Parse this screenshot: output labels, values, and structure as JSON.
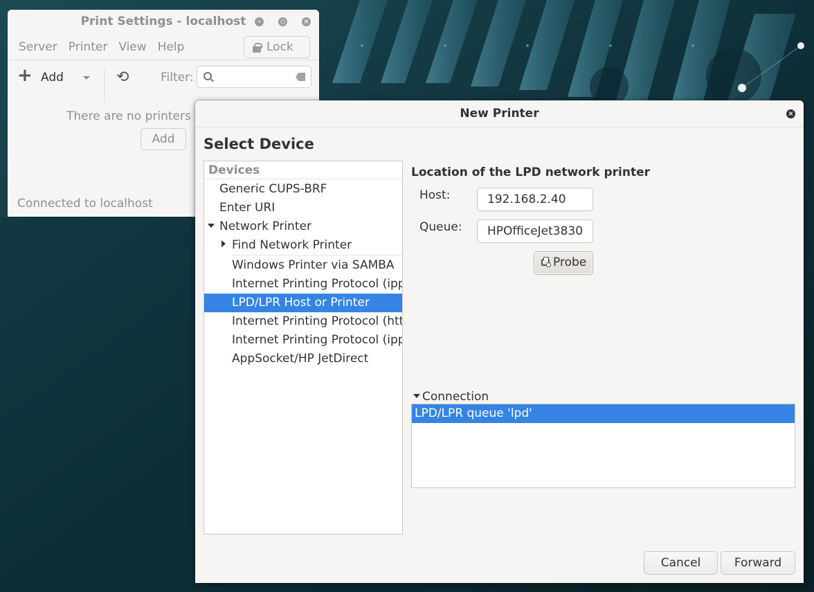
{
  "background_window": {
    "title": "Print Settings - localhost",
    "menu": [
      "Server",
      "Printer",
      "View",
      "Help"
    ],
    "lock_label": "Lock",
    "add_label": "Add",
    "filter_label": "Filter:",
    "filter_placeholder": "",
    "empty_message": "There are no printers co",
    "empty_add_label": "Add",
    "status": "Connected to localhost"
  },
  "dialog": {
    "title": "New Printer",
    "heading": "Select Device",
    "devices_header": "Devices",
    "devices": {
      "generic": "Generic CUPS-BRF",
      "enter_uri": "Enter URI",
      "network_printer": "Network Printer",
      "find_network": "Find Network Printer",
      "samba": "Windows Printer via SAMBA",
      "ipp": "Internet Printing Protocol (ipp)",
      "lpd": "LPD/LPR Host or Printer",
      "https": "Internet Printing Protocol (https",
      "ipps": "Internet Printing Protocol (ipps)",
      "appsocket": "AppSocket/HP JetDirect"
    },
    "selected_device": "LPD/LPR Host or Printer",
    "location_title": "Location of the LPD network printer",
    "host_label": "Host:",
    "host_value": "192.168.2.40",
    "queue_label": "Queue:",
    "queue_value": "HPOfficeJet3830",
    "probe_label": "Probe",
    "connection_label": "Connection",
    "connections": [
      "LPD/LPR queue 'lpd'"
    ],
    "cancel_label": "Cancel",
    "forward_label": "Forward"
  },
  "colors": {
    "selection": "#3584e4",
    "window_bg": "#f6f5f4",
    "desktop_bg": "#0c2a33"
  }
}
